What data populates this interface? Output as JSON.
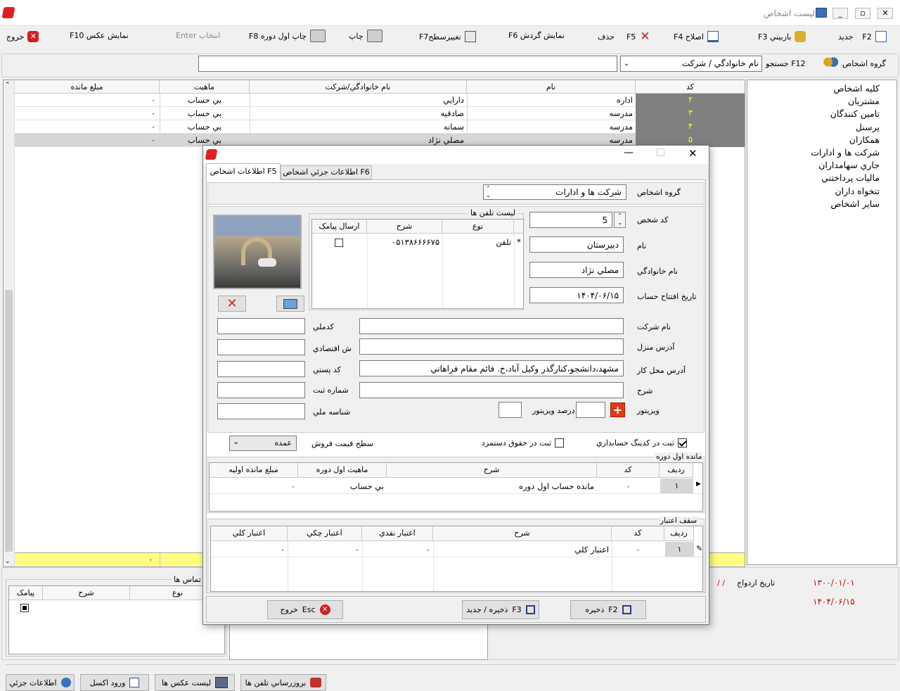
{
  "window": {
    "title": "ليست اشخاص"
  },
  "toolbar": {
    "new": "جديد",
    "new_key": "F2",
    "view": "بازبيني F3",
    "edit": "اصلاح F4",
    "delete": "حذف",
    "delete_key": "F5",
    "turnover": "نمايش گردش F6",
    "change_level": "تغييرسطحF7",
    "print": "چاپ",
    "print_opening": "چاپ اول دوره F8",
    "select": "انتخاب Enter",
    "show_image": "نمايش عکس F10",
    "exit": "خروج"
  },
  "search": {
    "group_label": "گروه اشخاص",
    "search_label": "F12 جستجو",
    "field_value": "نام خانوادگي / شرکت",
    "text": ""
  },
  "grid": {
    "headers": {
      "code": "کد",
      "name": "نام",
      "family": "نام خانوادگي/شرکت",
      "nature": "ماهيت",
      "balance": "مبلغ مانده"
    },
    "rows": [
      {
        "code": "۲",
        "name": "اداره",
        "family": "دارايي",
        "nature": "بي حساب",
        "balance": "۰"
      },
      {
        "code": "۳",
        "name": "مدرسه",
        "family": "صادقيه",
        "nature": "بي حساب",
        "balance": "۰"
      },
      {
        "code": "۴",
        "name": "مدرسه",
        "family": "سمانه",
        "nature": "بي حساب",
        "balance": "۰"
      },
      {
        "code": "۵",
        "name": "مدرسه",
        "family": "مصلي نژاد",
        "nature": "بي حساب",
        "balance": "۰"
      }
    ],
    "total": "۰"
  },
  "tree": [
    "کليه اشخاص",
    "مشتريان",
    "تامين کنندگان",
    "پرسنل",
    "همکاران",
    "شرکت ها و ادارات",
    "جاري سهامداران",
    "ماليات پرداختني",
    "تنخواه داران",
    "ساير اشخاص"
  ],
  "bottom": {
    "contacts_title": "تماس ها",
    "col_type": "نوع",
    "col_desc": "شرح",
    "col_sms": "پيامک",
    "marriage_label": "تاريخ ازدواج",
    "marriage_value": "/  /",
    "date1": "۱۳۰۰/۰۱/۰۱",
    "date2": "۱۴۰۴/۰۶/۱۵"
  },
  "bottom_buttons": {
    "details": "اطلاعات جزئي",
    "excel": "ورود اکسل",
    "images": "ليست عکس ها",
    "phone_update": "بروزرساني تلفن ها"
  },
  "dialog": {
    "tabs": {
      "info": "اطلاعات اشخاص F5",
      "detail": "اطلاعات جزئي اشخاص F6"
    },
    "group_label": "گروه اشخاص",
    "group_value": "شرکت ها و ادارات",
    "code_label": "کد شخص",
    "code_value": "5",
    "name_label": "نام",
    "name_value": "دبيرستان",
    "family_label": "نام خانوادگي",
    "family_value": "مصلي نژاد",
    "open_date_label": "تاريخ افتتاح حساب",
    "open_date_value": "۱۴۰۴/۰۶/۱۵",
    "phones": {
      "title": "ليست تلفن ها",
      "col_type": "نوع",
      "col_desc": "شرح",
      "col_sms": "ارسال پيامک",
      "row_type": "تلفن",
      "row_number": "۰۵۱۳۸۶۶۶۶۷۵"
    },
    "company_label": "نام شرکت",
    "company_value": "",
    "home_label": "آدرس منزل",
    "home_value": "",
    "work_label": "آدرس محل کار",
    "work_value": "مشهد،دانشجو،کنارگذر وکيل آباد،خ. قائم مقام فراهاني",
    "desc_label": "شرح",
    "desc_value": "",
    "national_code_label": "کدملي",
    "economic_label": "ش اقتصادي",
    "postal_label": "کد پستي",
    "reg_label": "شماره ثبت",
    "national_id_label": "شناسه ملي",
    "visitor_label": "ويزيتور",
    "visitor_pct_label": "درصد ويزيتور",
    "coding_label": "ثبت در کدينگ حسابداري",
    "commission_label": "ثبت در حقوق دستمزد",
    "price_level_label": "سطح قيمت فروش",
    "price_level_value": "عمده",
    "opening": {
      "title": "مانده اول دوره",
      "col_row": "رديف",
      "col_code": "کد",
      "col_desc": "شرح",
      "col_nature": "ماهيت اول دوره",
      "col_amount": "مبلغ مانده اوليه",
      "row": "۱",
      "code": "۰",
      "desc": "مانده حساب اول دوره",
      "nature": "بي حساب",
      "amount": "۰"
    },
    "credit": {
      "title": "سقف اعتبار",
      "col_row": "رديف",
      "col_code": "کد",
      "col_desc": "شرح",
      "col_cash": "اعتبار نقدي",
      "col_check": "اعتبار چکي",
      "col_total": "اعتبار کلي",
      "row": "۱",
      "code": "۰",
      "desc": "اعتبار کلي",
      "cash": "۰",
      "check": "۰",
      "total": "۰"
    },
    "buttons": {
      "save": "ذخيره",
      "save_key": "F2",
      "save_new": "ذخيره / جديد",
      "save_new_key": "F3",
      "exit": "خروج",
      "exit_key": "Esc"
    }
  },
  "colors": {
    "code_bg": "#808080",
    "code_fg": "#ffff00",
    "total_bg": "#ffff80",
    "selected": "#d6d6d6"
  }
}
